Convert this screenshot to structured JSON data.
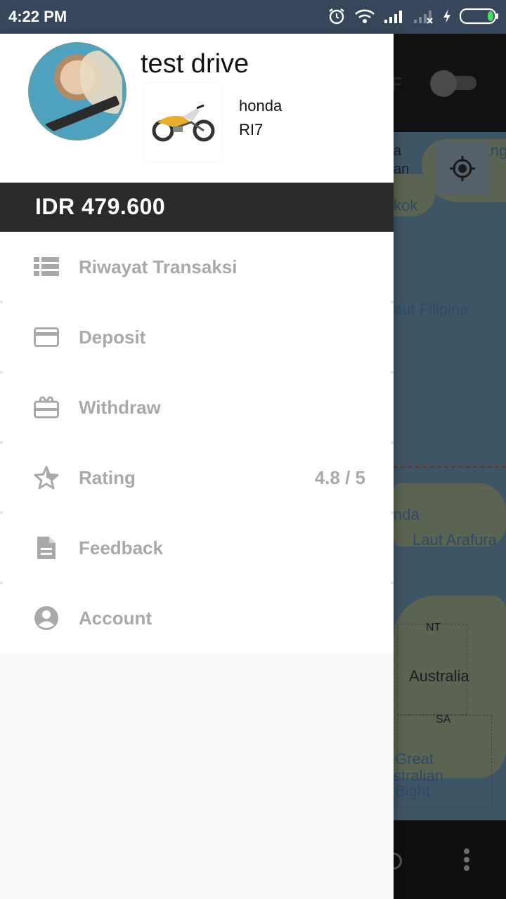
{
  "status_bar": {
    "time": "4:22 PM",
    "icons": [
      "alarm-icon",
      "wifi-icon",
      "signal-icon",
      "signal-x-icon",
      "charging-icon",
      "battery-icon"
    ]
  },
  "background_map": {
    "labels": {
      "japan": "Jepang",
      "left_top_a": "a",
      "left_top_an": "an",
      "bangkok": "kok",
      "philippine_sea": "aut Filipina",
      "banda": "nda",
      "arafura": "Laut Arafura",
      "nt": "NT",
      "australia": "Australia",
      "sa": "SA",
      "bight1": "Great",
      "bight2": "stralian",
      "bight3": "Bight",
      "top_letter": "F"
    }
  },
  "drawer": {
    "profile": {
      "name": "test drive",
      "vehicle_brand": "honda",
      "vehicle_plate": "RI7"
    },
    "balance": "IDR 479.600",
    "menu": [
      {
        "label": "Riwayat Transaksi",
        "icon": "list-icon",
        "value": ""
      },
      {
        "label": "Deposit",
        "icon": "credit-card-icon",
        "value": ""
      },
      {
        "label": "Withdraw",
        "icon": "gift-card-icon",
        "value": ""
      },
      {
        "label": "Rating",
        "icon": "star-icon",
        "value": "4.8 / 5"
      },
      {
        "label": "Feedback",
        "icon": "document-icon",
        "value": ""
      },
      {
        "label": "Account",
        "icon": "account-circle-icon",
        "value": ""
      }
    ]
  },
  "colors": {
    "status_bar": "#37465a",
    "balance_bar": "#2b2b2b",
    "menu_text": "#a9a9a9",
    "icon_gray": "#a9a9a9",
    "avatar_border": "#5aa0b2"
  }
}
